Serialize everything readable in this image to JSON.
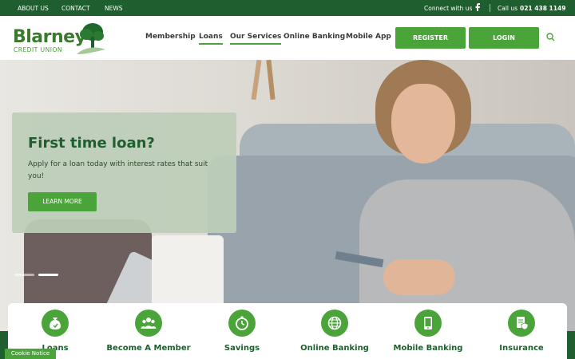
{
  "topbar": {
    "links": [
      "ABOUT US",
      "CONTACT",
      "NEWS"
    ],
    "connect_text": "Connect with us",
    "call_label": "Call us",
    "phone": "021 438 1149"
  },
  "logo": {
    "name": "Blarney",
    "sub": "CREDIT UNION"
  },
  "nav": {
    "items": [
      "Membership",
      "Loans",
      "Our Services",
      "Online Banking",
      "Mobile App"
    ],
    "register": "REGISTER",
    "login": "LOGIN"
  },
  "hero": {
    "title": "First time loan?",
    "text": "Apply for a loan today with interest rates that suit you!",
    "button": "LEARN MORE"
  },
  "services": [
    "Loans",
    "Become A Member",
    "Savings",
    "Online Banking",
    "Mobile Banking",
    "Insurance"
  ],
  "cookie": "Cookie Notice",
  "colors": {
    "primary": "#4aa43a",
    "dark": "#1f5e2e"
  }
}
